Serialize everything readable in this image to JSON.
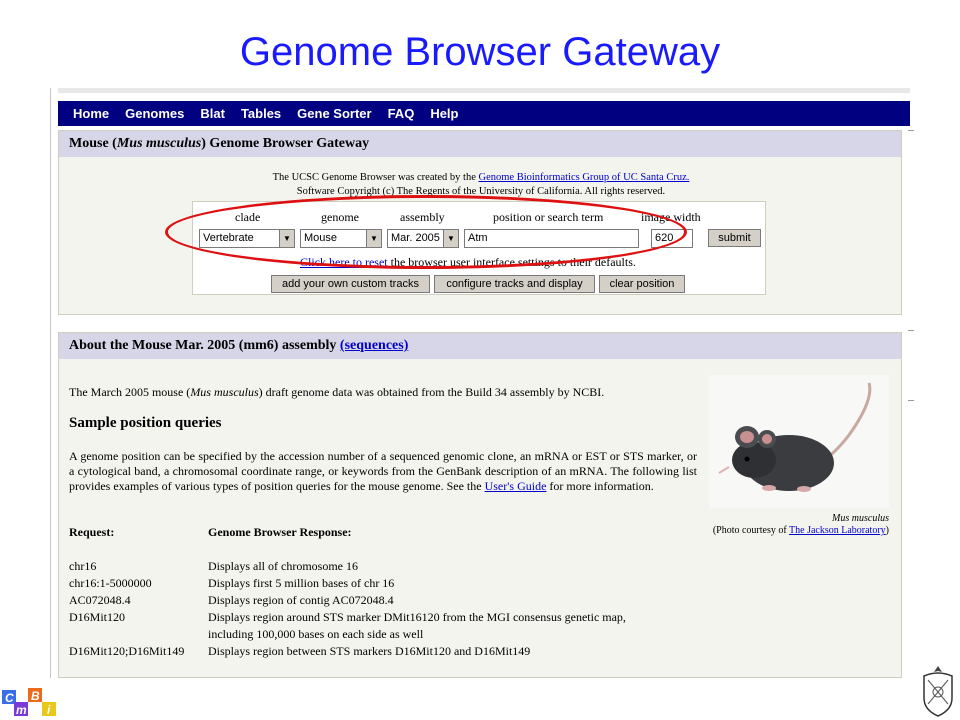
{
  "slide": {
    "title": "Genome Browser Gateway"
  },
  "nav": {
    "items": [
      "Home",
      "Genomes",
      "Blat",
      "Tables",
      "Gene Sorter",
      "FAQ",
      "Help"
    ]
  },
  "gateway": {
    "header_prefix": "Mouse (",
    "header_species": "Mus musculus",
    "header_suffix": ") Genome Browser Gateway",
    "intro_line1_prefix": "The UCSC Genome Browser was created by the ",
    "intro_link": "Genome Bioinformatics Group of UC Santa Cruz.",
    "intro_line2": "Software Copyright (c) The Regents of the University of California. All rights reserved.",
    "labels": {
      "clade": "clade",
      "genome": "genome",
      "assembly": "assembly",
      "position": "position or search term",
      "image_width": "image width"
    },
    "values": {
      "clade": "Vertebrate",
      "genome": "Mouse",
      "assembly": "Mar. 2005",
      "position": "Atm",
      "image_width": "620"
    },
    "submit": "submit",
    "reset_link": "Click here to reset",
    "reset_text": " the browser user interface settings to their defaults.",
    "buttons": {
      "custom_tracks": "add your own custom tracks",
      "configure": "configure tracks and display",
      "clear": "clear position"
    }
  },
  "about": {
    "header": "About the Mouse Mar. 2005 (mm6) assembly",
    "sequences_link": "(sequences)",
    "intro_prefix": "The March 2005 mouse (",
    "intro_species": "Mus musculus",
    "intro_suffix": ") draft genome data was obtained from the Build 34 assembly by NCBI.",
    "sample_heading": "Sample position queries",
    "desc_prefix": "A genome position can be specified by the accession number of a sequenced genomic clone, an mRNA or EST or STS marker, or a cytological band, a chromosomal coordinate range, or keywords from the GenBank description of an mRNA. The following list provides examples of various types of position queries for the mouse genome. See the ",
    "desc_link": "User's Guide",
    "desc_suffix": " for more information.",
    "caption_species": "Mus musculus",
    "caption_credit_prefix": "(Photo courtesy of ",
    "caption_credit_link": "The Jackson Laboratory",
    "caption_credit_suffix": ")",
    "request_header": "Request:",
    "response_header": "Genome Browser Response:",
    "queries": [
      {
        "request": "chr16",
        "response": "Displays all of chromosome 16"
      },
      {
        "request": "chr16:1-5000000",
        "response": "Displays first 5 million bases of chr 16"
      },
      {
        "request": "AC072048.4",
        "response": "Displays region of contig AC072048.4"
      },
      {
        "request": "D16Mit120",
        "response": "Displays region around STS marker DMit16120 from the MGI consensus genetic map,",
        "response2": "including 100,000 bases on each side as well"
      },
      {
        "request": "D16Mit120;D16Mit149",
        "response": "Displays region between STS markers D16Mit120 and D16Mit149"
      }
    ]
  },
  "footer": {
    "logo_letters": [
      "C",
      "m",
      "B",
      "i"
    ]
  },
  "colors": {
    "title": "#1a1aff",
    "nav": "#000080",
    "oval": "#dd1111",
    "link": "#0000cc"
  },
  "icons": {
    "logo": "cmbi-logo-icon",
    "seal": "university-seal-icon",
    "mouse": "mouse-photo"
  }
}
